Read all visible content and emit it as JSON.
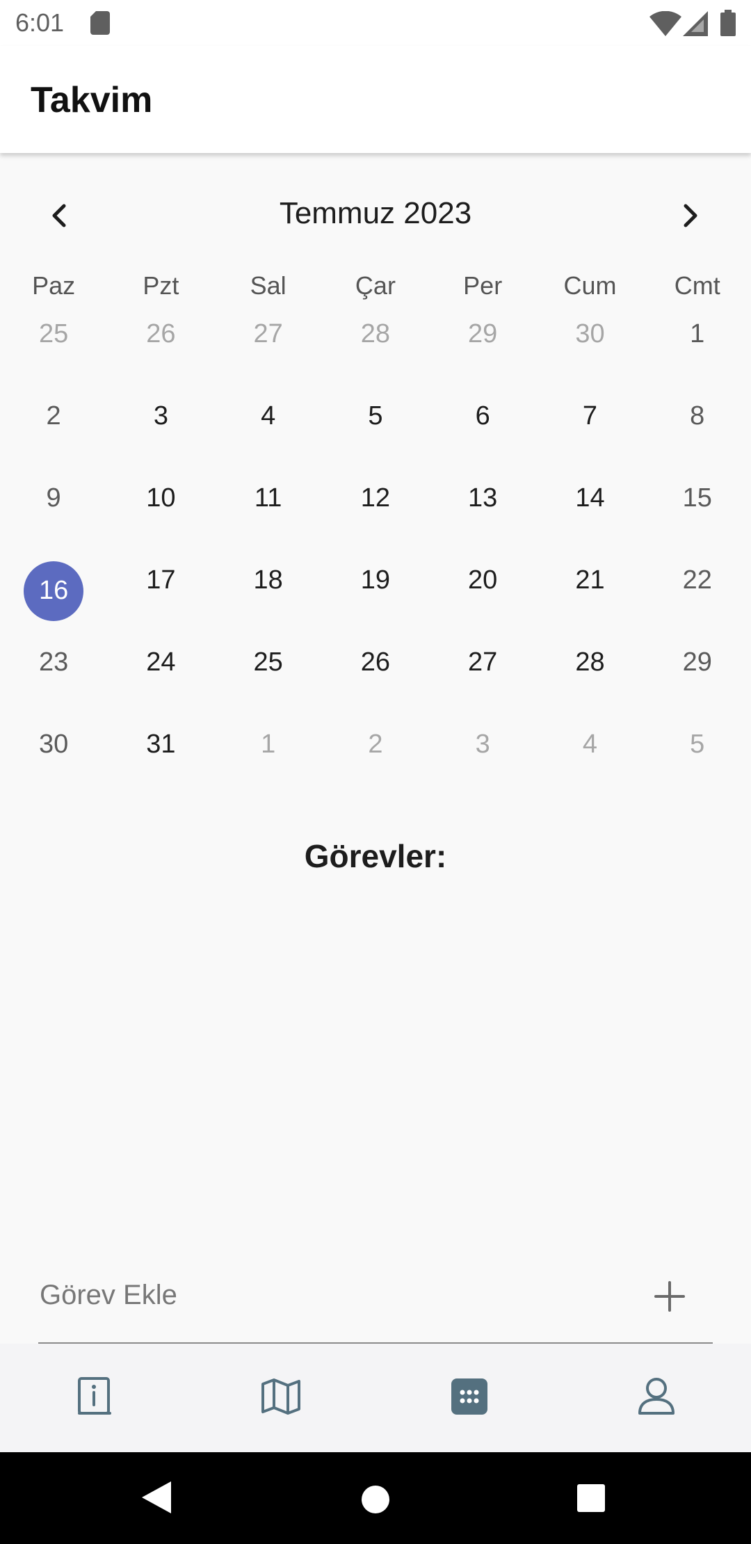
{
  "status_bar": {
    "time": "6:01"
  },
  "app_bar": {
    "title": "Takvim"
  },
  "calendar": {
    "month_title": "Temmuz 2023",
    "weekdays": [
      "Paz",
      "Pzt",
      "Sal",
      "Çar",
      "Per",
      "Cum",
      "Cmt"
    ],
    "weeks": [
      [
        "25",
        "26",
        "27",
        "28",
        "29",
        "30",
        "1"
      ],
      [
        "2",
        "3",
        "4",
        "5",
        "6",
        "7",
        "8"
      ],
      [
        "9",
        "10",
        "11",
        "12",
        "13",
        "14",
        "15"
      ],
      [
        "16",
        "17",
        "18",
        "19",
        "20",
        "21",
        "22"
      ],
      [
        "23",
        "24",
        "25",
        "26",
        "27",
        "28",
        "29"
      ],
      [
        "30",
        "31",
        "1",
        "2",
        "3",
        "4",
        "5"
      ]
    ],
    "selected_day": "16",
    "accent_color": "#5c6bc0"
  },
  "tasks": {
    "title": "Görevler:"
  },
  "add_task": {
    "placeholder": "Görev Ekle"
  },
  "bottom_nav": {
    "items": [
      {
        "icon": "info-book-icon",
        "active": false
      },
      {
        "icon": "map-icon",
        "active": false
      },
      {
        "icon": "calendar-grid-icon",
        "active": true
      },
      {
        "icon": "profile-icon",
        "active": false
      }
    ]
  }
}
